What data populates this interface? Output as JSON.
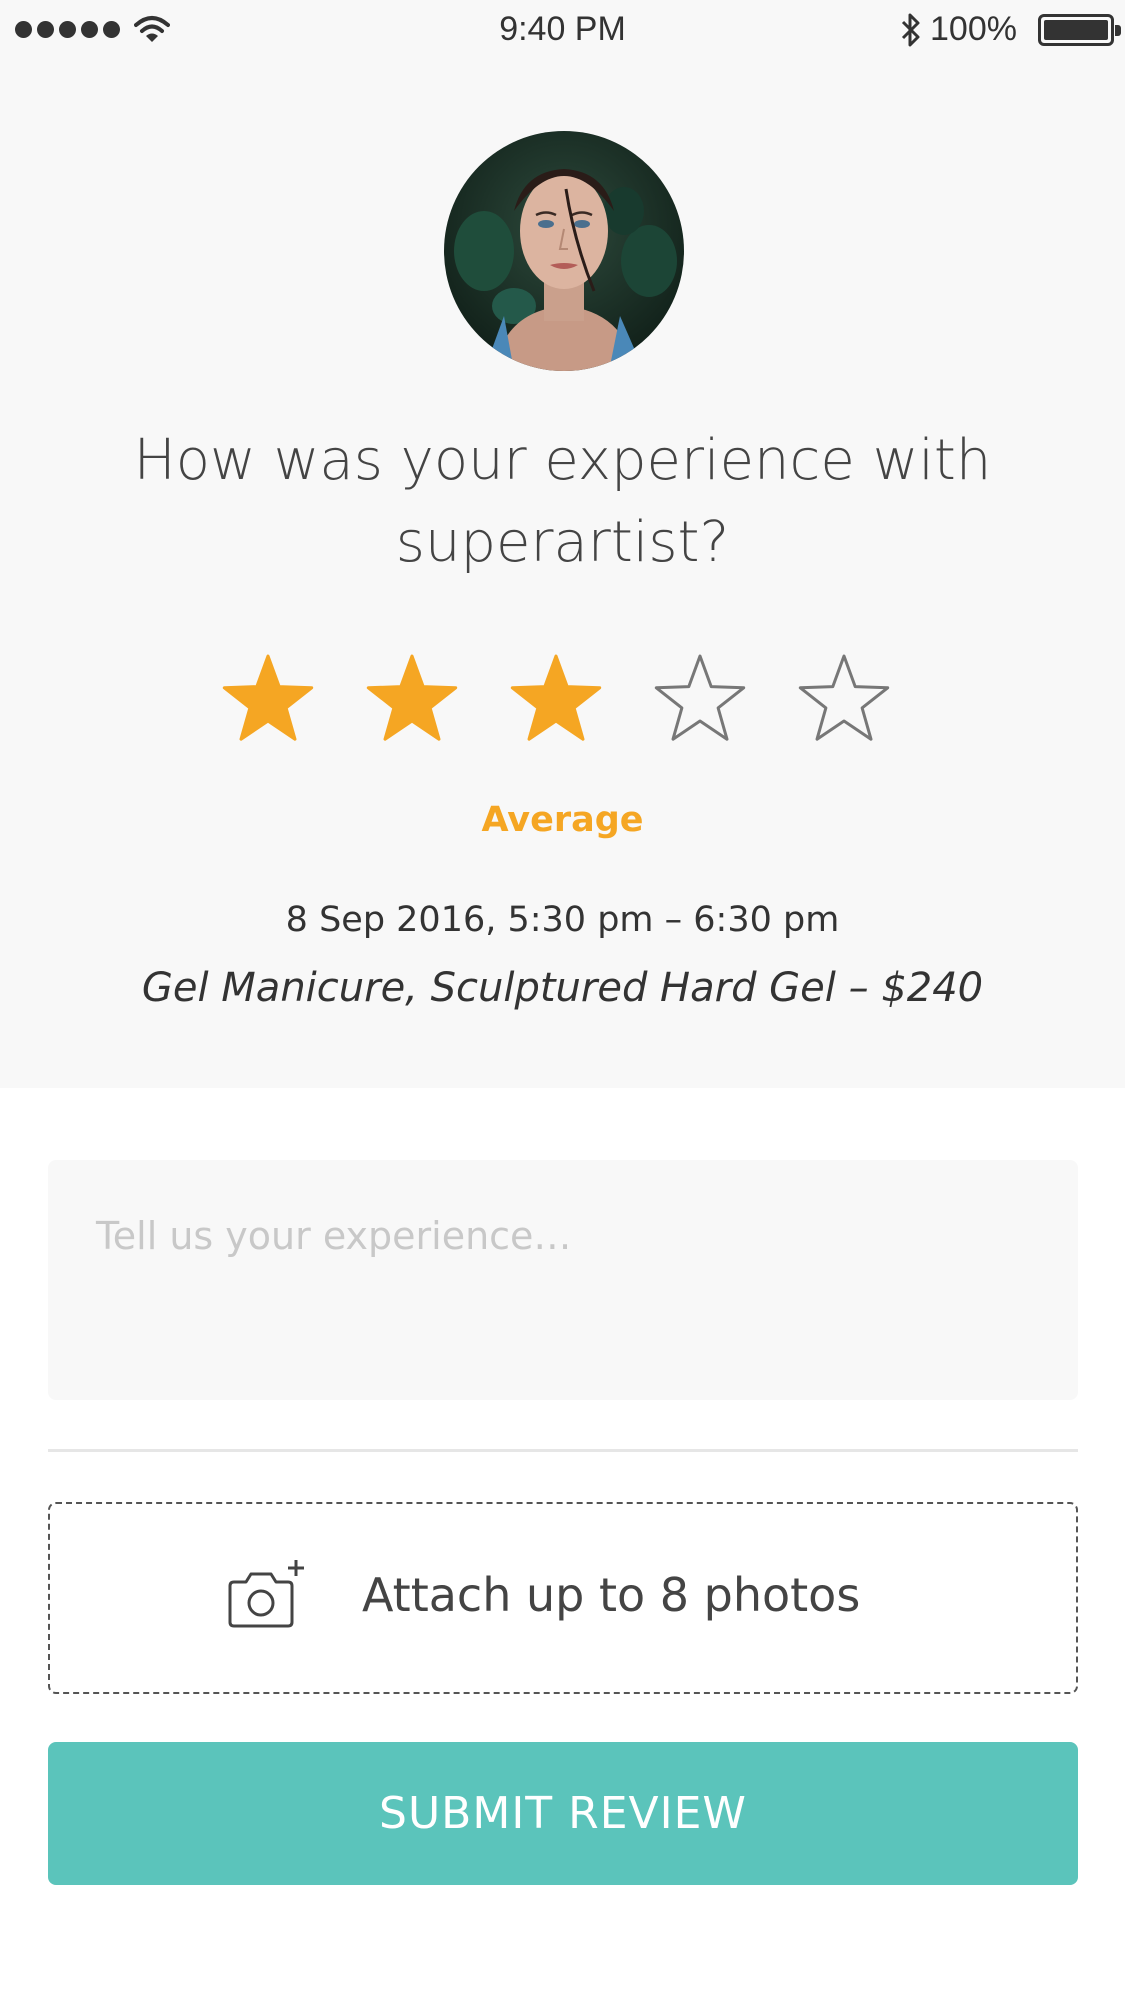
{
  "status_bar": {
    "time": "9:40 PM",
    "battery": "100%",
    "icons": [
      "signal-icon",
      "wifi-icon",
      "bluetooth-icon",
      "battery-icon"
    ]
  },
  "profile": {
    "avatar": "artist-portrait-photo"
  },
  "review": {
    "question": "How was your experience with superartist?",
    "rating": 3,
    "rating_max": 5,
    "rating_label": "Average",
    "appointment_time": "8 Sep 2016, 5:30 pm – 6:30 pm",
    "service": "Gel Manicure, Sculptured Hard Gel – $240",
    "comment_placeholder": "Tell us your experience…",
    "comment_value": ""
  },
  "attach": {
    "label": "Attach up to 8 photos",
    "icon": "camera-add-icon"
  },
  "submit": {
    "label": "SUBMIT REVIEW"
  },
  "colors": {
    "accent": "#f5a623",
    "button": "#5bc4bb",
    "empty_star": "#777777",
    "top_background": "#f8f8f8"
  }
}
